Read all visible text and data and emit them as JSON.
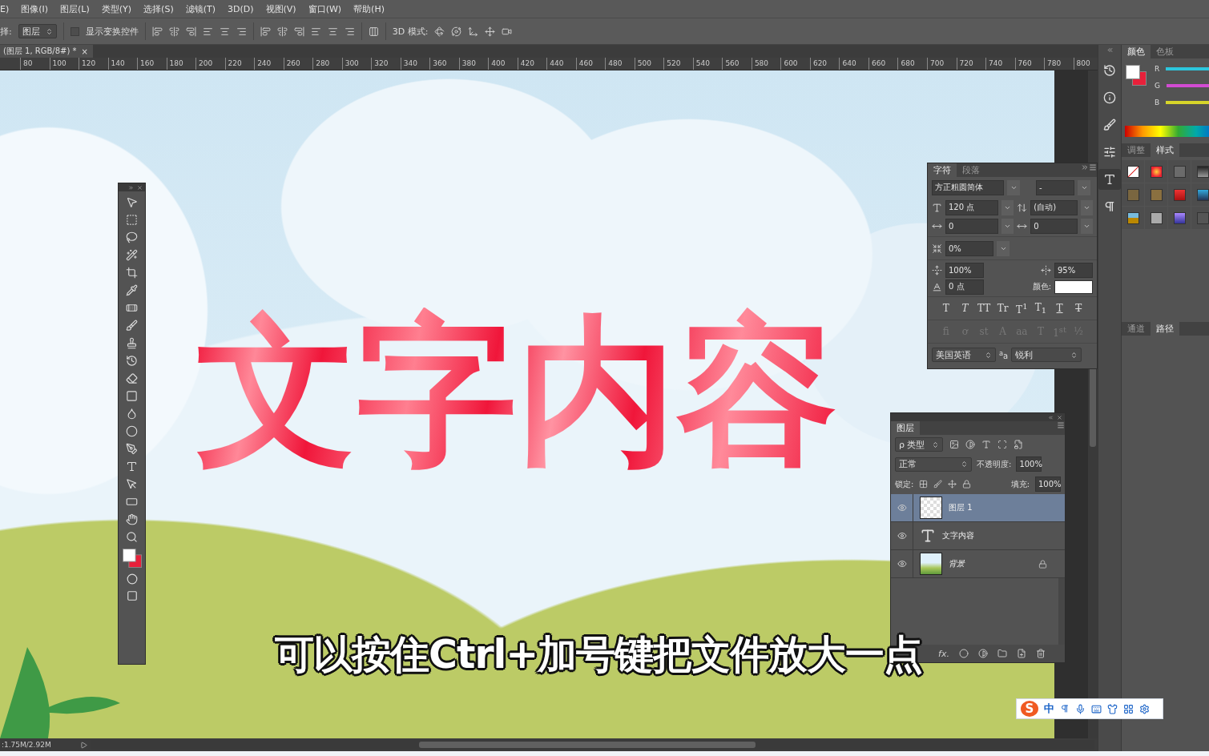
{
  "menu": [
    "E)",
    "图像(I)",
    "图层(L)",
    "类型(Y)",
    "选择(S)",
    "滤镜(T)",
    "3D(D)",
    "视图(V)",
    "窗口(W)",
    "帮助(H)"
  ],
  "options_bar": {
    "label": "择:",
    "select": "图层",
    "show_transform": {
      "label": "显示变换控件",
      "checked": false
    },
    "mode_3d": "3D 模式:"
  },
  "document_tab": {
    "title": "(图层 1, RGB/8#) *",
    "close": "×"
  },
  "ruler": [
    "80",
    "100",
    "120",
    "140",
    "160",
    "180",
    "200",
    "220",
    "240",
    "260",
    "280",
    "300",
    "320",
    "340",
    "360",
    "380",
    "400",
    "420",
    "440",
    "460",
    "480",
    "500",
    "520",
    "540",
    "560",
    "580",
    "600",
    "620",
    "640",
    "660",
    "680",
    "700",
    "720",
    "740",
    "760",
    "780",
    "800"
  ],
  "canvas": {
    "headline": "文字内容"
  },
  "character_panel": {
    "tabs": [
      {
        "label": "字符",
        "selected": true
      },
      {
        "label": "段落",
        "selected": false
      }
    ],
    "font_family": "方正粗圆简体",
    "font_style": "-",
    "size": "120 点",
    "leading": "(自动)",
    "kerning": "0",
    "tracking": "0",
    "tsume": "0%",
    "vertical_scale": "100%",
    "horizontal_scale": "95%",
    "baseline_shift": "0 点",
    "color_label": "颜色:",
    "style_buttons": [
      {
        "label": "T",
        "kind": "plain"
      },
      {
        "label": "T",
        "kind": "italic"
      },
      {
        "label": "TT",
        "kind": "plain"
      },
      {
        "label": "Tr",
        "kind": "plain"
      },
      {
        "label": "T$^{1}$",
        "kind": "plain"
      },
      {
        "label": "T$_{1}$",
        "kind": "plain"
      },
      {
        "label": "T",
        "kind": "underline"
      },
      {
        "label": "T",
        "kind": "strike"
      }
    ],
    "opentype_buttons": [
      "fi",
      "ơ",
      "st",
      "A",
      "aa",
      "T",
      "1$^{st}$",
      "½"
    ],
    "language": "美国英语",
    "antialias_icon": "$^{a}$a",
    "antialias": "锐利"
  },
  "layers_panel": {
    "tab": "图层",
    "filter": "ρ 类型",
    "blend": "正常",
    "opacity_label": "不透明度:",
    "opacity": "100%",
    "lock_label": "锁定:",
    "fill_label": "填充:",
    "fill": "100%",
    "layers": [
      {
        "kind": "pixel",
        "name": "图层 1",
        "selected": true,
        "visible": true,
        "locked": false
      },
      {
        "kind": "text",
        "name": "文字内容",
        "selected": false,
        "visible": true,
        "locked": false
      },
      {
        "kind": "image",
        "name": "背景",
        "selected": false,
        "visible": true,
        "locked": true
      }
    ],
    "footer_fx": "fx."
  },
  "color_panel": {
    "tabs": [
      {
        "label": "颜色",
        "selected": true
      },
      {
        "label": "色板",
        "selected": false
      }
    ],
    "channels": [
      "R",
      "G",
      "B"
    ]
  },
  "styles_panel": {
    "tabs": [
      {
        "label": "调整",
        "selected": false
      },
      {
        "label": "样式",
        "selected": true
      }
    ]
  },
  "paths_panel": {
    "tabs": [
      {
        "label": "通道",
        "selected": false
      },
      {
        "label": "路径",
        "selected": true
      }
    ]
  },
  "status": ":1.75M/2.92M",
  "subtitle": "可以按住Ctrl+加号键把文件放大一点",
  "ime": {
    "logo": "S",
    "mode": "中"
  }
}
